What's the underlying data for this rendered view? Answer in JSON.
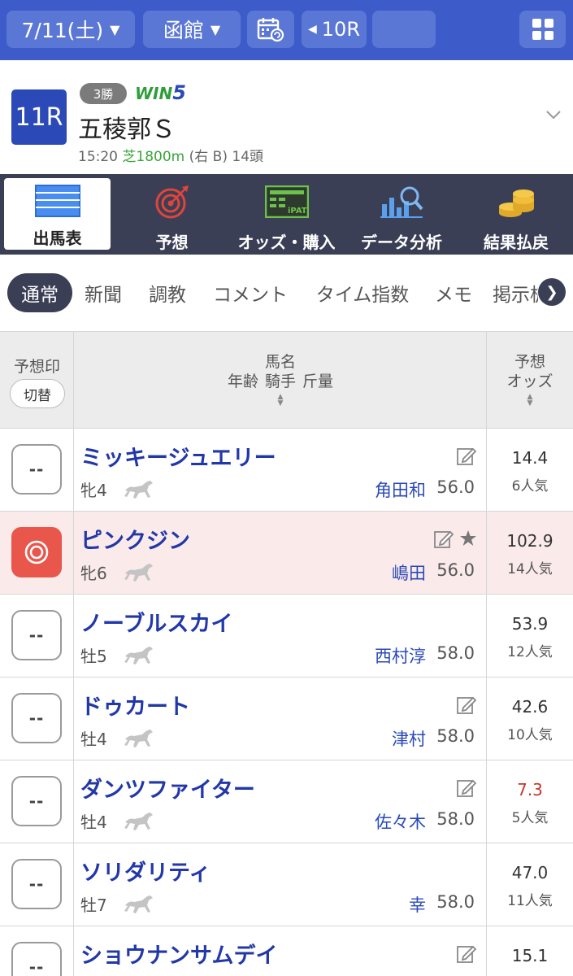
{
  "topbar": {
    "date": "7/11(土)",
    "venue": "函館",
    "prev_race": "10R",
    "next_race": "",
    "icons": {
      "calendar": "calendar-refresh-icon",
      "grid": "grid-menu-icon"
    }
  },
  "race": {
    "number": "11R",
    "grade": "3勝",
    "win5": "WIN",
    "win5_num": "5",
    "name": "五稜郭Ｓ",
    "time": "15:20",
    "surface": "芝1800m",
    "course": "(右 B)",
    "runners": "14頭"
  },
  "main_menu": [
    {
      "label": "出馬表",
      "icon": "table-icon",
      "active": true
    },
    {
      "label": "予想",
      "icon": "target-icon",
      "active": false
    },
    {
      "label": "オッズ・購入",
      "icon": "ipat-icon",
      "active": false
    },
    {
      "label": "データ分析",
      "icon": "chart-search-icon",
      "active": false
    },
    {
      "label": "結果払戻",
      "icon": "coins-icon",
      "active": false
    }
  ],
  "sub_tabs": [
    "通常",
    "新聞",
    "調教",
    "コメント",
    "タイム指数",
    "メモ",
    "掲示板"
  ],
  "table": {
    "header": {
      "mark": "予想印",
      "toggle": "切替",
      "name_l1": "馬名",
      "name_l2a": "年齢",
      "name_l2b": "騎手",
      "name_l2c": "斤量",
      "odds_l1": "予想",
      "odds_l2": "オッズ"
    },
    "rows": [
      {
        "mark": "--",
        "name": "ミッキージュエリー",
        "age": "牝4",
        "jockey": "角田和",
        "weight": "56.0",
        "odds": "14.4",
        "pop": "6人気",
        "memo": true,
        "star": false,
        "selected": false
      },
      {
        "mark": "◎",
        "name": "ピンクジン",
        "age": "牝6",
        "jockey": "嶋田",
        "weight": "56.0",
        "odds": "102.9",
        "pop": "14人気",
        "memo": true,
        "star": true,
        "selected": true
      },
      {
        "mark": "--",
        "name": "ノーブルスカイ",
        "age": "牡5",
        "jockey": "西村淳",
        "weight": "58.0",
        "odds": "53.9",
        "pop": "12人気",
        "memo": false,
        "star": false,
        "selected": false
      },
      {
        "mark": "--",
        "name": "ドゥカート",
        "age": "牡4",
        "jockey": "津村",
        "weight": "58.0",
        "odds": "42.6",
        "pop": "10人気",
        "memo": true,
        "star": false,
        "selected": false
      },
      {
        "mark": "--",
        "name": "ダンツファイター",
        "age": "牡4",
        "jockey": "佐々木",
        "weight": "58.0",
        "odds": "7.3",
        "pop": "5人気",
        "memo": true,
        "star": false,
        "selected": false,
        "odds_red": true
      },
      {
        "mark": "--",
        "name": "ソリダリティ",
        "age": "牡7",
        "jockey": "幸",
        "weight": "58.0",
        "odds": "47.0",
        "pop": "11人気",
        "memo": false,
        "star": false,
        "selected": false
      },
      {
        "mark": "--",
        "name": "ショウナンサムデイ",
        "age": "",
        "jockey": "",
        "weight": "",
        "odds": "15.1",
        "pop": "",
        "memo": true,
        "star": false,
        "selected": false
      }
    ]
  },
  "colors": {
    "topbar": "#3d5bc9",
    "menu": "#3b3f56",
    "horse_name": "#2238a8",
    "selected_mark": "#e8564c",
    "highlight_row": "#fbeaea"
  }
}
